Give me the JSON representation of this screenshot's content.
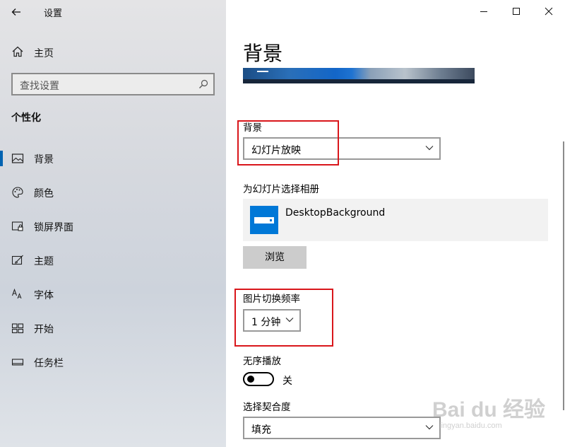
{
  "window": {
    "app_title": "设置"
  },
  "sidebar": {
    "home_label": "主页",
    "search_placeholder": "查找设置",
    "section_title": "个性化",
    "items": [
      {
        "label": "背景",
        "icon": "picture-icon",
        "selected": true
      },
      {
        "label": "颜色",
        "icon": "palette-icon",
        "selected": false
      },
      {
        "label": "锁屏界面",
        "icon": "lock-screen-icon",
        "selected": false
      },
      {
        "label": "主题",
        "icon": "theme-brush-icon",
        "selected": false
      },
      {
        "label": "字体",
        "icon": "font-icon",
        "selected": false
      },
      {
        "label": "开始",
        "icon": "start-grid-icon",
        "selected": false
      },
      {
        "label": "任务栏",
        "icon": "taskbar-icon",
        "selected": false
      }
    ]
  },
  "main": {
    "title": "背景",
    "background_label": "背景",
    "background_value": "幻灯片放映",
    "album_label": "为幻灯片选择相册",
    "album_name": "DesktopBackground",
    "browse_label": "浏览",
    "frequency_label": "图片切换频率",
    "frequency_value": "1 分钟",
    "shuffle_label": "无序播放",
    "shuffle_state": "关",
    "shuffle_on": false,
    "fit_label": "选择契合度",
    "fit_value": "填充"
  },
  "watermark": {
    "main": "Bai du 经验",
    "sub": "jingyan.baidu.com"
  },
  "colors": {
    "accent": "#0078d7",
    "selection_bar": "#0063b1",
    "highlight_box": "#d9161b",
    "button_gray": "#cccccc"
  }
}
